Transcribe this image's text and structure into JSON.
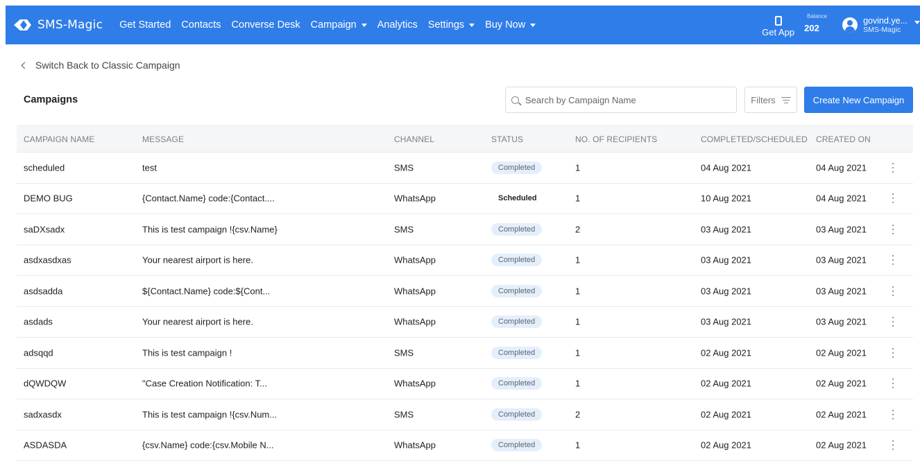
{
  "brand": {
    "name": "SMS-Magic"
  },
  "nav": {
    "items": [
      {
        "label": "Get Started",
        "dropdown": false
      },
      {
        "label": "Contacts",
        "dropdown": false
      },
      {
        "label": "Converse Desk",
        "dropdown": false
      },
      {
        "label": "Campaign",
        "dropdown": true
      },
      {
        "label": "Analytics",
        "dropdown": false
      },
      {
        "label": "Settings",
        "dropdown": true
      },
      {
        "label": "Buy Now",
        "dropdown": true
      }
    ],
    "get_app_label": "Get App",
    "balance_label": "Balance",
    "balance_value": "202",
    "user_name": "govind.ye...",
    "user_org": "SMS-Magic"
  },
  "back_link": "Switch Back to Classic Campaign",
  "page_title": "Campaigns",
  "search": {
    "placeholder": "Search by Campaign Name"
  },
  "filters_label": "Filters",
  "create_button": "Create New Campaign",
  "table": {
    "headers": {
      "name": "CAMPAIGN NAME",
      "message": "MESSAGE",
      "channel": "CHANNEL",
      "status": "STATUS",
      "recipients": "NO. OF RECIPIENTS",
      "completed": "COMPLETED/SCHEDULED",
      "created": "CREATED ON"
    },
    "rows": [
      {
        "name": "scheduled",
        "message": "test",
        "channel": "SMS",
        "status": "Completed",
        "recipients": "1",
        "completed": "04 Aug 2021",
        "created": "04 Aug 2021"
      },
      {
        "name": "DEMO BUG",
        "message": "{Contact.Name} code:{Contact....",
        "channel": "WhatsApp",
        "status": "Scheduled",
        "recipients": "1",
        "completed": "10 Aug 2021",
        "created": "04 Aug 2021"
      },
      {
        "name": "saDXsadx",
        "message": "This is test campaign !{csv.Name}",
        "channel": "SMS",
        "status": "Completed",
        "recipients": "2",
        "completed": "03 Aug 2021",
        "created": "03 Aug 2021"
      },
      {
        "name": "asdxasdxas",
        "message": "Your nearest airport is here.",
        "channel": "WhatsApp",
        "status": "Completed",
        "recipients": "1",
        "completed": "03 Aug 2021",
        "created": "03 Aug 2021"
      },
      {
        "name": "asdsadda",
        "message": "${Contact.Name} code:${Cont...",
        "channel": "WhatsApp",
        "status": "Completed",
        "recipients": "1",
        "completed": "03 Aug 2021",
        "created": "03 Aug 2021"
      },
      {
        "name": "asdads",
        "message": "Your nearest airport is here.",
        "channel": "WhatsApp",
        "status": "Completed",
        "recipients": "1",
        "completed": "03 Aug 2021",
        "created": "03 Aug 2021"
      },
      {
        "name": "adsqqd",
        "message": "This is test campaign !",
        "channel": "SMS",
        "status": "Completed",
        "recipients": "1",
        "completed": "02 Aug 2021",
        "created": "02 Aug 2021"
      },
      {
        "name": "dQWDQW",
        "message": "\"Case Creation Notification: T...",
        "channel": "WhatsApp",
        "status": "Completed",
        "recipients": "1",
        "completed": "02 Aug 2021",
        "created": "02 Aug 2021"
      },
      {
        "name": "sadxasdx",
        "message": "This is test campaign !{csv.Num...",
        "channel": "SMS",
        "status": "Completed",
        "recipients": "2",
        "completed": "02 Aug 2021",
        "created": "02 Aug 2021"
      },
      {
        "name": "ASDASDA",
        "message": "{csv.Name} code:{csv.Mobile N...",
        "channel": "WhatsApp",
        "status": "Completed",
        "recipients": "1",
        "completed": "02 Aug 2021",
        "created": "02 Aug 2021"
      }
    ]
  },
  "colors": {
    "primary": "#2f7de8",
    "pill_bg": "#e5effb",
    "header_bg": "#f5f6f8"
  }
}
